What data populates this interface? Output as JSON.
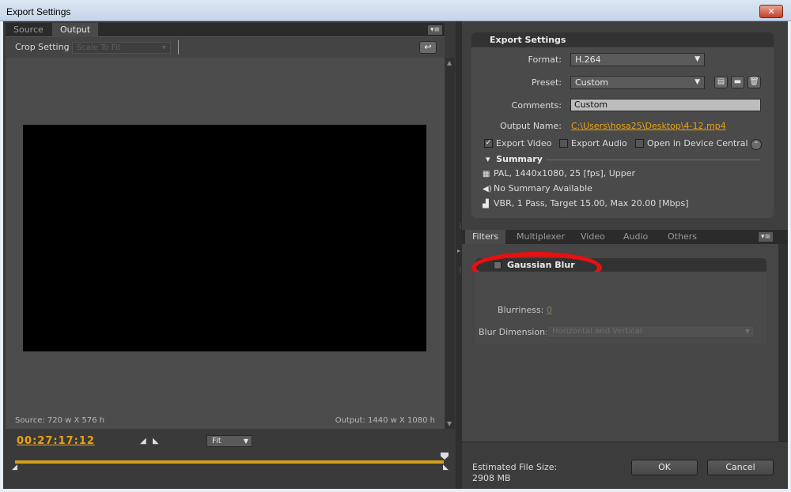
{
  "window": {
    "title": "Export Settings",
    "close_glyph": "✕"
  },
  "left": {
    "tabs": [
      {
        "label": "Source"
      },
      {
        "label": "Output"
      }
    ],
    "crop": {
      "label": "Crop Setting",
      "value": "Scale To Fit"
    },
    "source_info": "Source: 720 w X 576 h",
    "output_info": "Output: 1440 w X 1080 h",
    "timecode": "00:27:17:12",
    "fit": "Fit"
  },
  "right": {
    "section_title": "Export Settings",
    "format": {
      "label": "Format:",
      "value": "H.264"
    },
    "preset": {
      "label": "Preset:",
      "value": "Custom"
    },
    "comments": {
      "label": "Comments:",
      "value": "Custom"
    },
    "output_name": {
      "label": "Output Name:",
      "value": "C:\\Users\\hosa25\\Desktop\\4-12.mp4"
    },
    "checkboxes": [
      {
        "label": "Export Video",
        "checked": true
      },
      {
        "label": "Export Audio",
        "checked": false
      },
      {
        "label": "Open in Device Central",
        "checked": false
      }
    ],
    "summary": {
      "title": "Summary",
      "lines": [
        "PAL, 1440x1080, 25 [fps], Upper",
        "No Summary Available",
        "VBR, 1 Pass, Target 15.00, Max 20.00 [Mbps]"
      ]
    },
    "tabs": [
      {
        "label": "Filters"
      },
      {
        "label": "Multiplexer"
      },
      {
        "label": "Video"
      },
      {
        "label": "Audio"
      },
      {
        "label": "Others"
      }
    ],
    "filter": {
      "name": "Gaussian Blur",
      "blurriness_label": "Blurriness:",
      "blurriness_value": "0",
      "dimension_label": "Blur Dimension:",
      "dimension_value": "Horizontal and Vertical"
    },
    "estimate": {
      "label": "Estimated File Size:",
      "value": "2908 MB"
    },
    "ok_label": "OK",
    "cancel_label": "Cancel"
  },
  "colors": {
    "accent": "#e8a317",
    "annotation": "#e81010"
  }
}
